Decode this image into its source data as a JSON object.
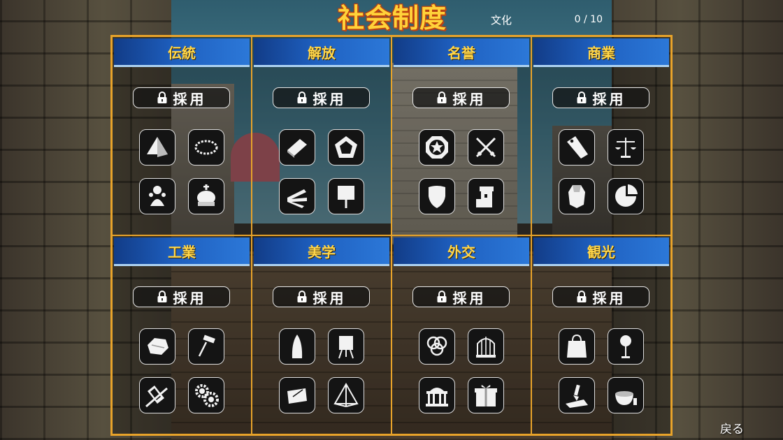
{
  "header": {
    "title": "社会制度",
    "culture_label": "文化",
    "culture_value": "0 / 10"
  },
  "adopt_label": "採用",
  "back_label": "戻る",
  "categories": [
    {
      "name": "伝統",
      "icons": [
        "pyramid-icon",
        "thorn-wreath-icon",
        "statue-icon",
        "crown-icon"
      ]
    },
    {
      "name": "解放",
      "icons": [
        "book-icon",
        "pentagon-shield-icon",
        "hand-icon",
        "placard-icon"
      ]
    },
    {
      "name": "名誉",
      "icons": [
        "star-medal-icon",
        "crossed-swords-icon",
        "shield-icon",
        "tower-icon"
      ]
    },
    {
      "name": "商業",
      "icons": [
        "price-tag-icon",
        "scales-icon",
        "gem-icon",
        "pie-chart-icon"
      ]
    },
    {
      "name": "工業",
      "icons": [
        "ore-icon",
        "hammer-icon",
        "ruler-icon",
        "gears-icon"
      ]
    },
    {
      "name": "美学",
      "icons": [
        "obelisk-icon",
        "easel-icon",
        "scroll-icon",
        "prism-icon"
      ]
    },
    {
      "name": "外交",
      "icons": [
        "three-rings-icon",
        "birdcage-icon",
        "parliament-icon",
        "gift-box-icon"
      ]
    },
    {
      "name": "観光",
      "icons": [
        "shopping-bag-icon",
        "signpost-icon",
        "brush-canvas-icon",
        "bowl-icon"
      ]
    }
  ]
}
